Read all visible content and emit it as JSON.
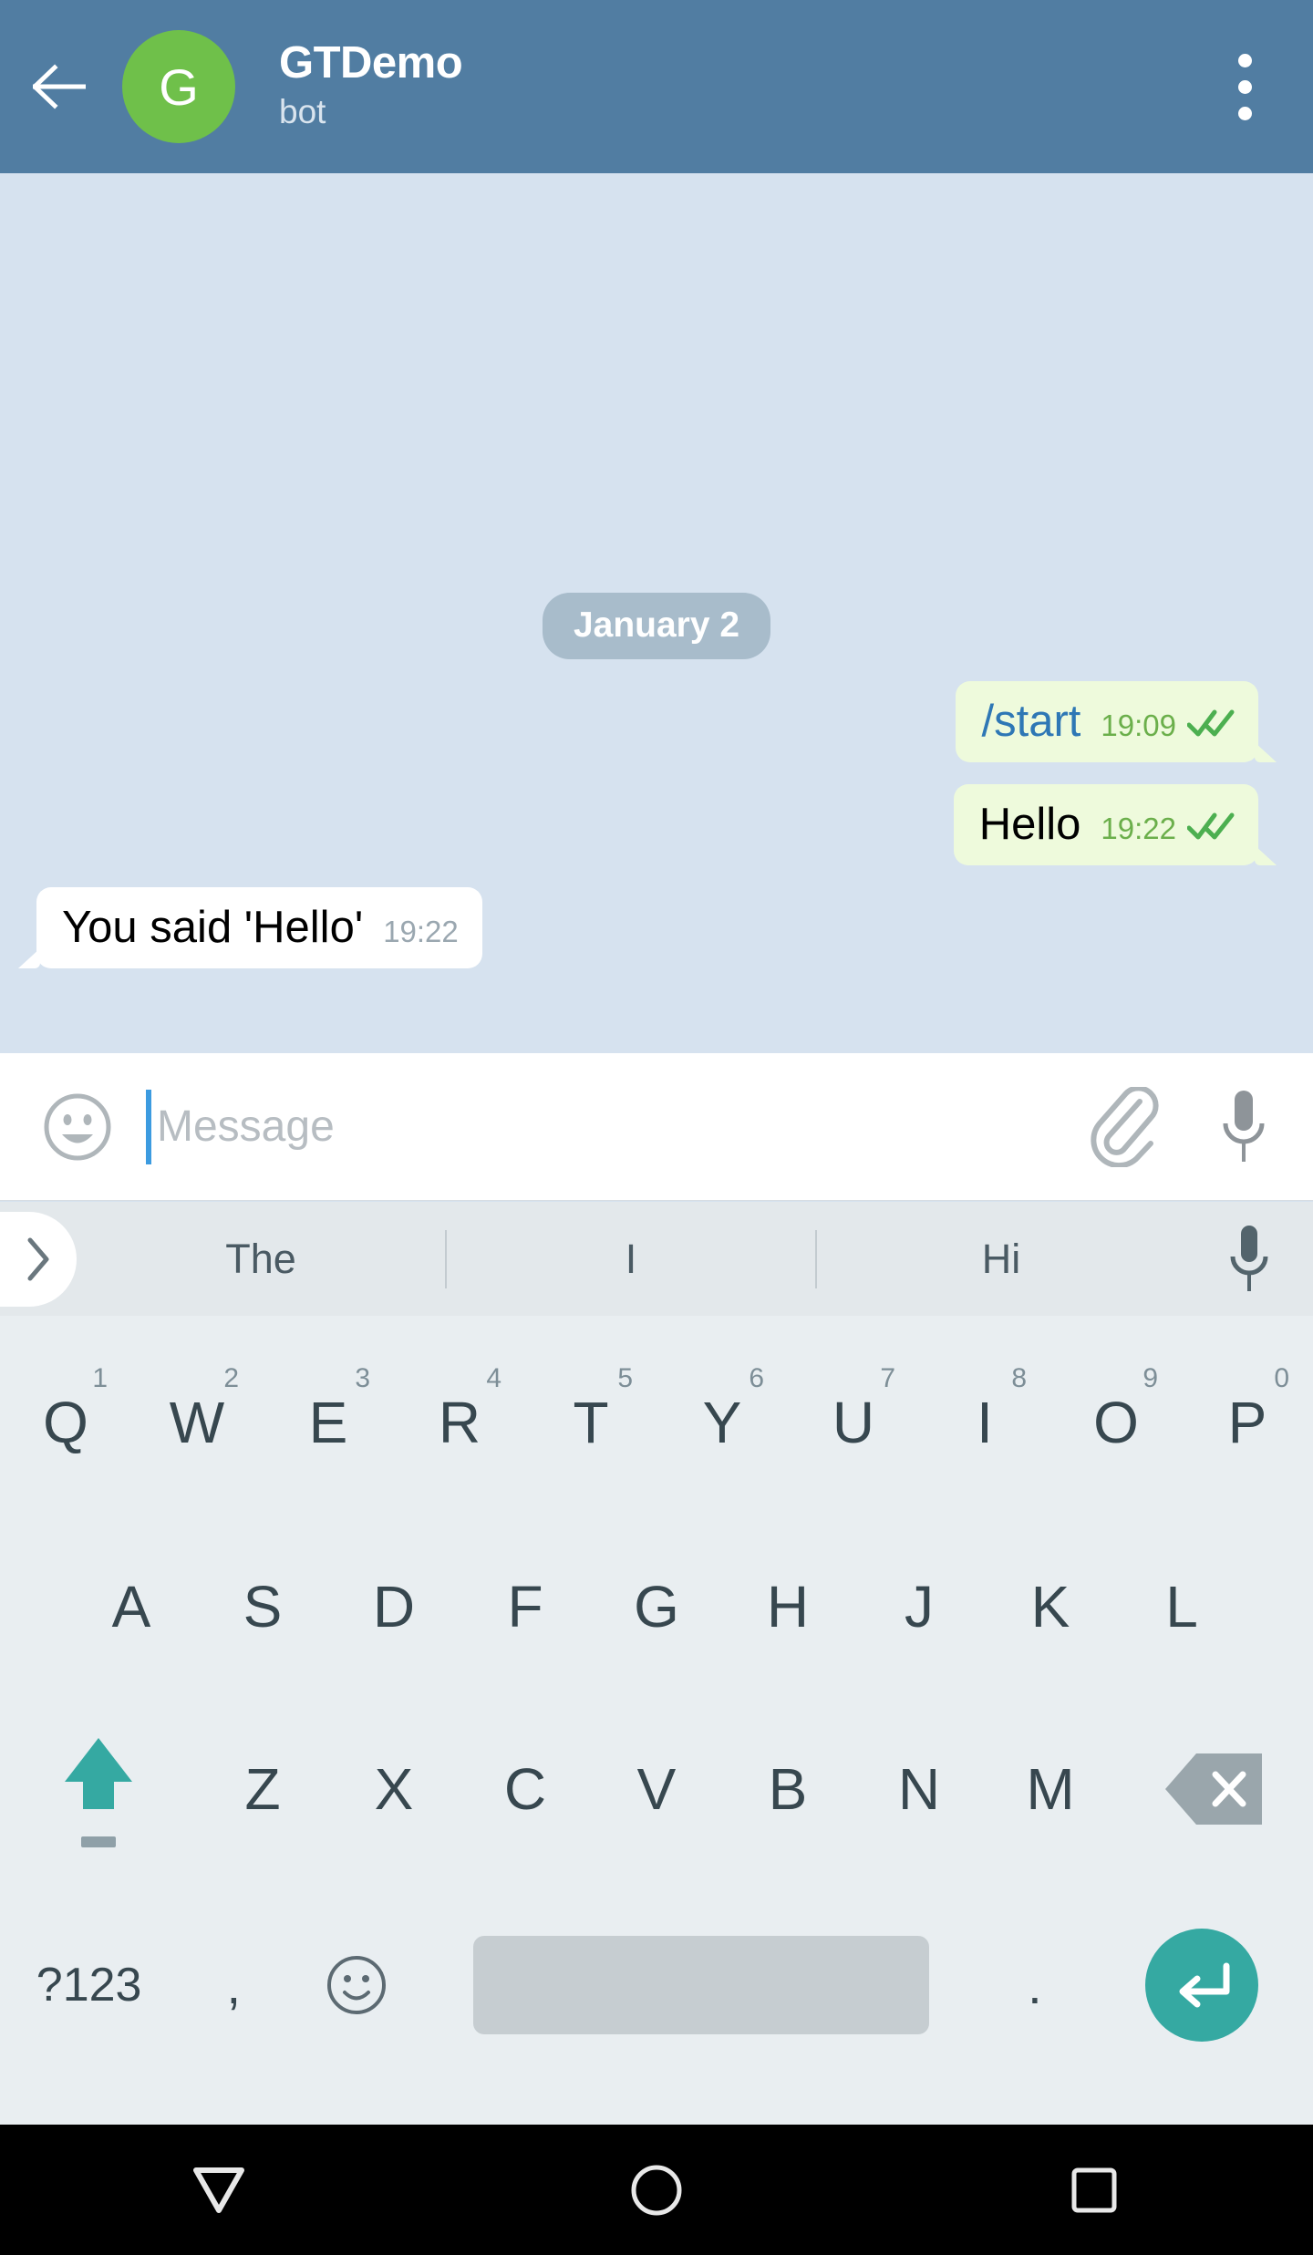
{
  "header": {
    "back_icon": "back-arrow-icon",
    "avatar_letter": "G",
    "avatar_color": "#6FC04A",
    "title": "GTDemo",
    "subtitle": "bot",
    "menu_icon": "overflow-menu-icon",
    "bg_color": "#517DA2"
  },
  "chat": {
    "background_color": "#D6E2EF",
    "date_separator": "January 2",
    "messages": [
      {
        "text": "/start",
        "time": "19:09",
        "direction": "out",
        "is_command": true,
        "status_icon": "double-check-icon",
        "bubble_color": "#EEFADC",
        "text_color": "#2E77B5"
      },
      {
        "text": "Hello",
        "time": "19:22",
        "direction": "out",
        "is_command": false,
        "status_icon": "double-check-icon",
        "bubble_color": "#EEFADC",
        "text_color": "#000000"
      },
      {
        "text": "You said 'Hello'",
        "time": "19:22",
        "direction": "in",
        "is_command": false,
        "status_icon": "",
        "bubble_color": "#FFFFFF",
        "text_color": "#000000"
      }
    ]
  },
  "input_bar": {
    "emoji_icon": "smiley-face-icon",
    "placeholder": "Message",
    "value": "",
    "attach_icon": "paperclip-icon",
    "mic_icon": "microphone-icon",
    "caret_color": "#3C9BE0"
  },
  "suggestions": {
    "expand_icon": "chevron-right-icon",
    "items": [
      "The",
      "I",
      "Hi"
    ],
    "mic_icon": "microphone-icon",
    "bg_color": "#E3E8EB"
  },
  "keyboard": {
    "bg_color": "#E9EEF1",
    "row1": [
      {
        "letter": "Q",
        "digit": "1"
      },
      {
        "letter": "W",
        "digit": "2"
      },
      {
        "letter": "E",
        "digit": "3"
      },
      {
        "letter": "R",
        "digit": "4"
      },
      {
        "letter": "T",
        "digit": "5"
      },
      {
        "letter": "Y",
        "digit": "6"
      },
      {
        "letter": "U",
        "digit": "7"
      },
      {
        "letter": "I",
        "digit": "8"
      },
      {
        "letter": "O",
        "digit": "9"
      },
      {
        "letter": "P",
        "digit": "0"
      }
    ],
    "row2": [
      "A",
      "S",
      "D",
      "F",
      "G",
      "H",
      "J",
      "K",
      "L"
    ],
    "row3": [
      "Z",
      "X",
      "C",
      "V",
      "B",
      "N",
      "M"
    ],
    "shift_icon": "shift-arrow-icon",
    "shift_color": "#35A9A2",
    "backspace_icon": "backspace-delete-icon",
    "symbols_label": "?123",
    "comma_label": ",",
    "emoji_icon": "smiley-face-icon",
    "space_label": "",
    "period_label": ".",
    "enter_icon": "enter-return-icon",
    "enter_color": "#35A9A2"
  },
  "navbar": {
    "back_icon": "nav-back-down-triangle-icon",
    "home_icon": "nav-home-circle-icon",
    "recents_icon": "nav-recents-square-icon",
    "bg_color": "#000000"
  }
}
